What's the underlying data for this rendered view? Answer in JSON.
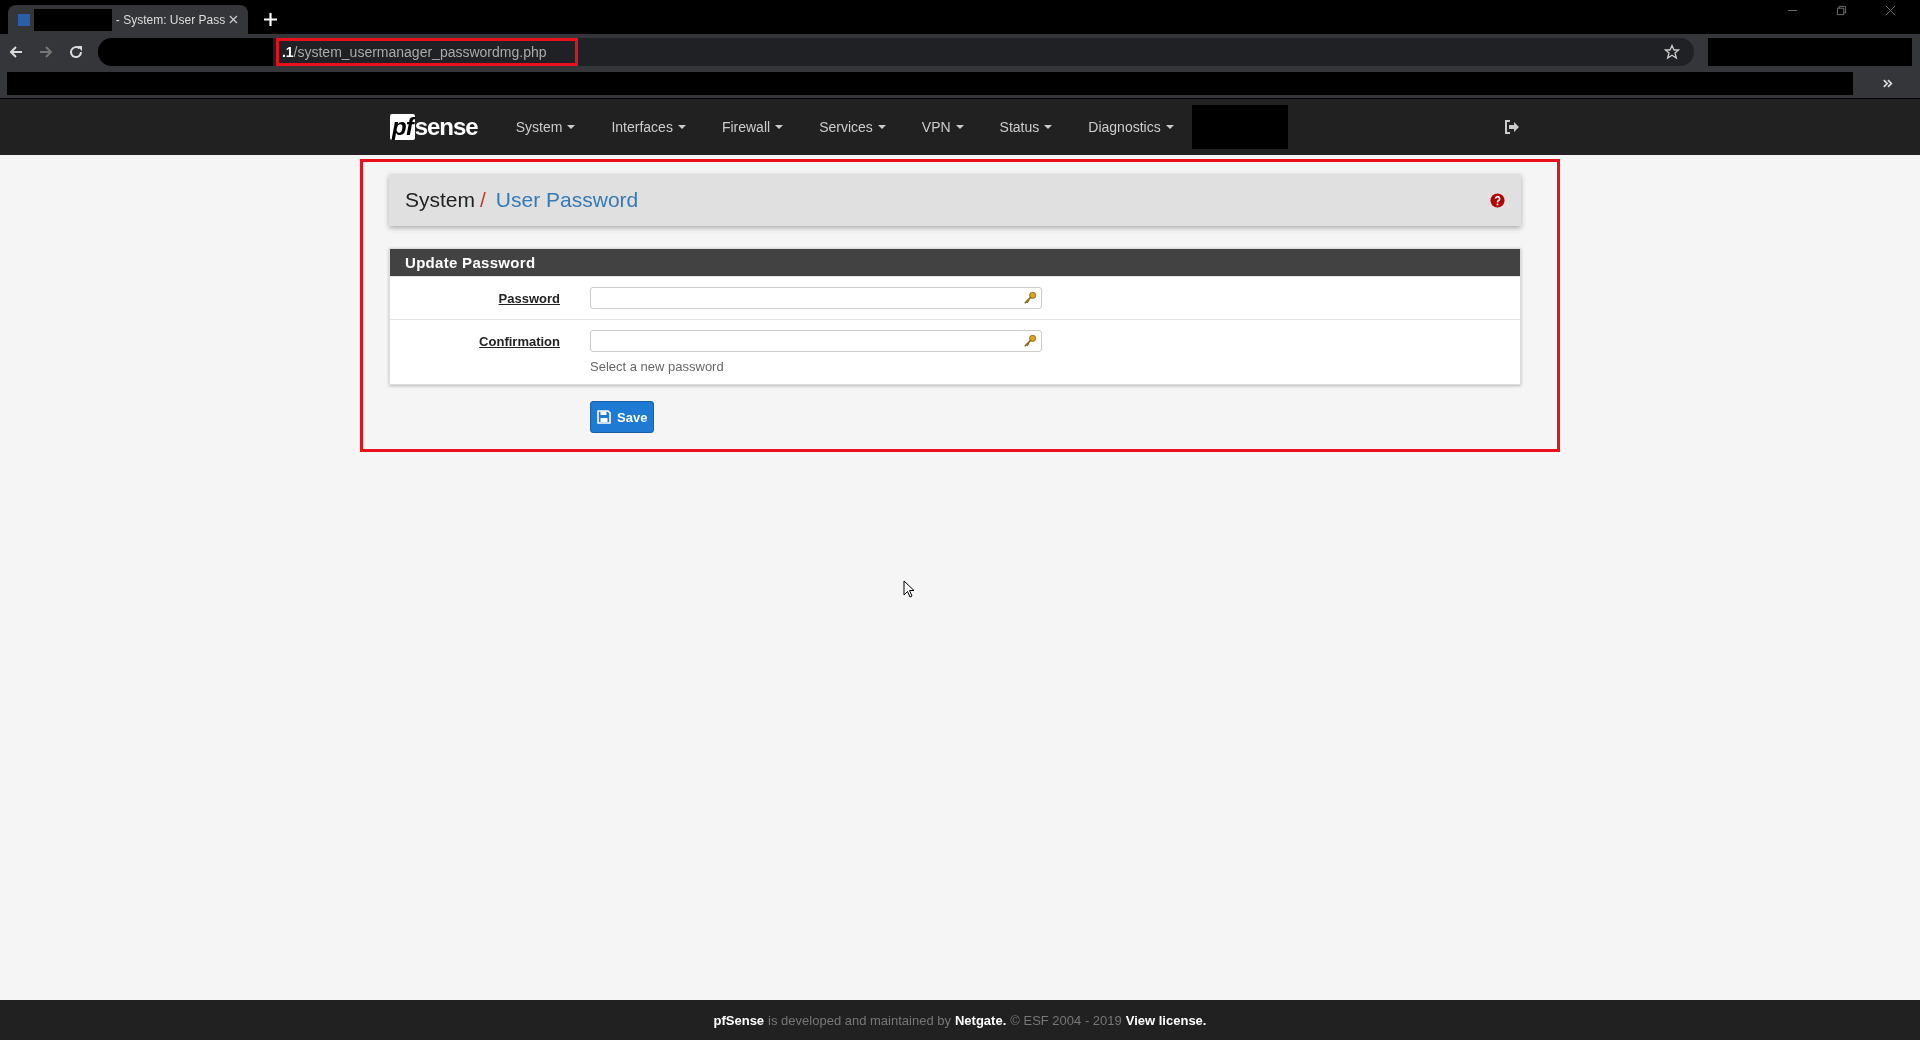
{
  "browser": {
    "tab": {
      "title": "- System: User Pass"
    },
    "address": "**.1**/system_usermanager_passwordmg.php"
  },
  "navbar": {
    "logo": {
      "mark": "pf",
      "word": "sense"
    },
    "menus": [
      {
        "label": "System"
      },
      {
        "label": "Interfaces"
      },
      {
        "label": "Firewall"
      },
      {
        "label": "Services"
      },
      {
        "label": "VPN"
      },
      {
        "label": "Status"
      },
      {
        "label": "Diagnostics"
      }
    ]
  },
  "breadcrumb": {
    "parent": "System",
    "separator": "/",
    "current": "User Password"
  },
  "panel": {
    "title": "Update Password",
    "fields": [
      {
        "label": "Password"
      },
      {
        "label": "Confirmation",
        "help": "Select a new password"
      }
    ]
  },
  "save_button": "Save",
  "footer": {
    "brand": "pfSense",
    "text_1": "is developed and maintained by",
    "link_1": "Netgate.",
    "text_2": "© ESF 2004 - 2019",
    "link_2": "View license."
  }
}
